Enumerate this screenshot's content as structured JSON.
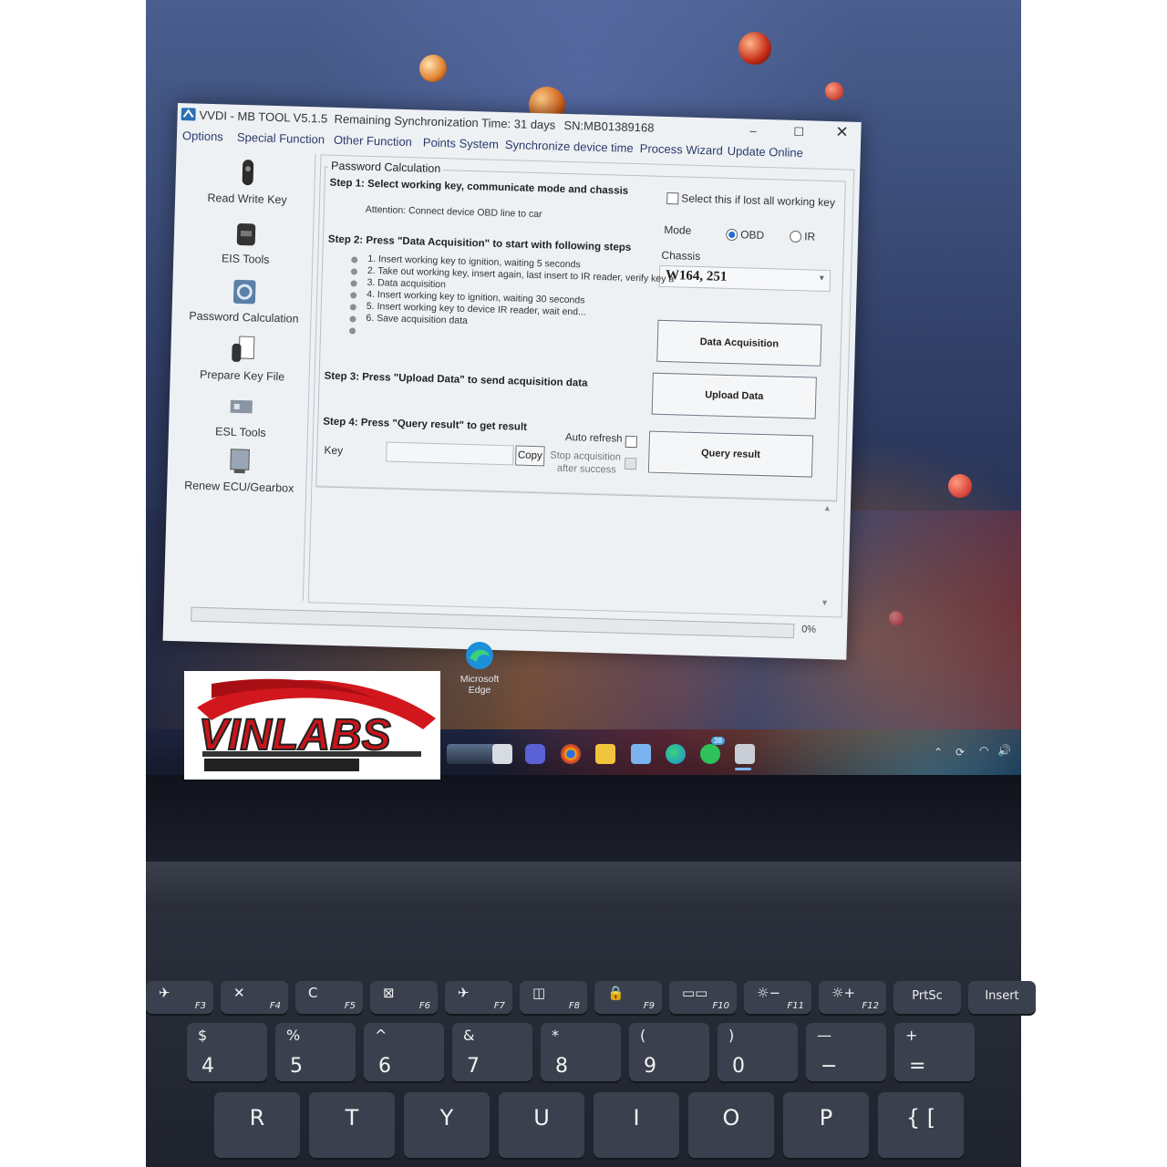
{
  "app": {
    "title": "VVDI - MB TOOL V5.1.5",
    "sync_time": "Remaining Synchronization Time: 31 days",
    "serial": "SN:MB01389168",
    "menu": [
      "Options",
      "Special Function",
      "Other Function",
      "Points System",
      "Synchronize device time",
      "Process Wizard",
      "Update Online"
    ],
    "sidebar": [
      {
        "label": "Read Write Key",
        "icon": "car-key-icon"
      },
      {
        "label": "EIS Tools",
        "icon": "eis-icon"
      },
      {
        "label": "Password Calculation",
        "icon": "password-calc-icon"
      },
      {
        "label": "Prepare Key File",
        "icon": "key-file-icon"
      },
      {
        "label": "ESL Tools",
        "icon": "esl-icon"
      },
      {
        "label": "Renew ECU/Gearbox",
        "icon": "ecu-icon"
      }
    ],
    "panel_title": "Password Calculation",
    "step1": {
      "title": "Step 1: Select working key, communicate mode and chassis",
      "attention": "Attention: Connect device OBD line to car",
      "lost_key_label": "Select this if lost all working key",
      "mode_label": "Mode",
      "mode_options": [
        "OBD",
        "IR"
      ],
      "mode_selected": "OBD",
      "chassis_label": "Chassis",
      "chassis_value": "W164, 251"
    },
    "step2": {
      "title": "Step 2: Press \"Data Acquisition\" to start with following steps",
      "items": [
        "1. Insert working key to ignition, waiting 5 seconds",
        "2. Take out working key, insert again, last insert to IR reader, verify key a",
        "3. Data acquisition",
        "4. Insert working key to ignition, waiting 30 seconds",
        "5. Insert working key to device IR reader, wait end...",
        "6. Save acquisition data"
      ],
      "button": "Data Acquisition"
    },
    "step3": {
      "title": "Step 3: Press \"Upload Data\" to send acquisition data",
      "button": "Upload Data"
    },
    "step4": {
      "title": "Step 4: Press \"Query result\" to get result",
      "key_label": "Key",
      "key_value": "",
      "copy_button": "Copy",
      "auto_refresh_label": "Auto refresh",
      "stop_label_1": "Stop acquisition",
      "stop_label_2": "after success",
      "button": "Query result"
    },
    "progress_text": "0%",
    "progress": 0
  },
  "desktop": {
    "edge_shortcut_1": "Microsoft",
    "edge_shortcut_2": "Edge",
    "taskbar_notification_count": "38"
  },
  "watermark": "VINLABS",
  "keyboard": {
    "fn_row": [
      {
        "icon": "✈",
        "fn": "F3"
      },
      {
        "icon": "✕",
        "fn": "F4"
      },
      {
        "icon": "C",
        "fn": "F5"
      },
      {
        "icon": "⊠",
        "fn": "F6"
      },
      {
        "icon": "✈",
        "fn": "F7"
      },
      {
        "icon": "◫",
        "fn": "F8"
      },
      {
        "icon": "🔒",
        "fn": "F9"
      },
      {
        "icon": "▭▭",
        "fn": "F10"
      },
      {
        "icon": "☼−",
        "fn": "F11"
      },
      {
        "icon": "☼+",
        "fn": "F12"
      },
      {
        "icon": "PrtSc",
        "fn": ""
      },
      {
        "icon": "Insert",
        "fn": ""
      }
    ],
    "num_row": [
      {
        "top": "$",
        "bot": "4"
      },
      {
        "top": "%",
        "bot": "5"
      },
      {
        "top": "^",
        "bot": "6"
      },
      {
        "top": "&",
        "bot": "7"
      },
      {
        "top": "*",
        "bot": "8"
      },
      {
        "top": "(",
        "bot": "9"
      },
      {
        "top": ")",
        "bot": "0"
      },
      {
        "top": "—",
        "bot": "−"
      },
      {
        "top": "+",
        "bot": "="
      }
    ],
    "letter_row": [
      "R",
      "T",
      "Y",
      "U",
      "I",
      "O",
      "P",
      "{ ["
    ]
  }
}
